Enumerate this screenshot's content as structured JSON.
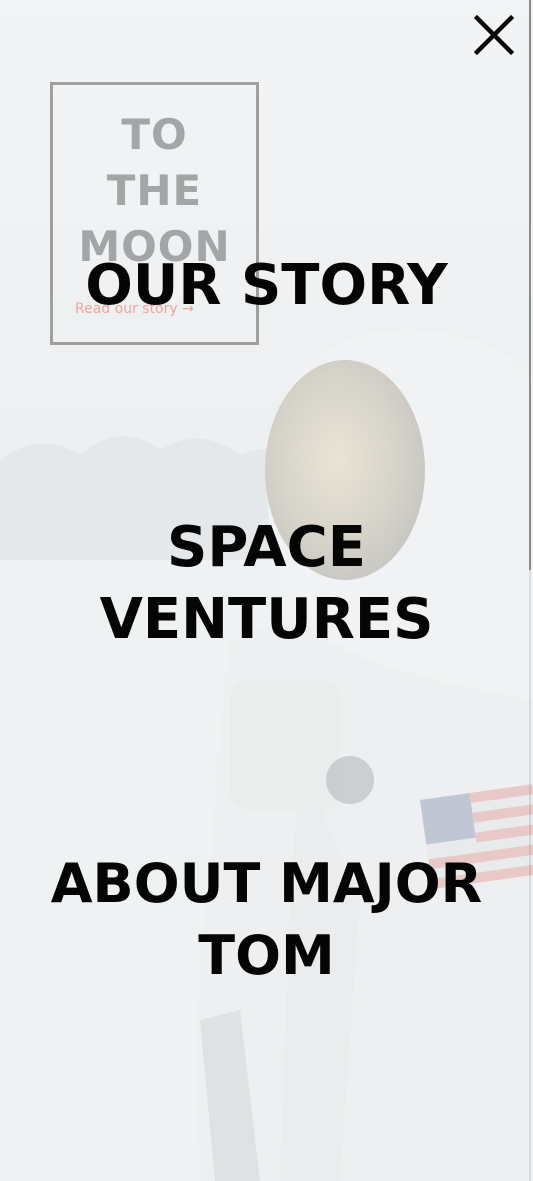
{
  "hero": {
    "title": "TO\nTHE\nMOON",
    "link": "Read our story →"
  },
  "menu": {
    "items": [
      {
        "lines": [
          "OUR STORY"
        ]
      },
      {
        "lines": [
          "SPACE",
          "VENTURES"
        ]
      },
      {
        "lines": [
          "ABOUT MAJOR",
          "TOM"
        ]
      }
    ]
  },
  "icons": {
    "close": "close-icon"
  },
  "colors": {
    "menu_text": "#050505",
    "overlay": "#f5f7f8",
    "hero_text": "#a3a5a6",
    "link_accent": "#f0a49a"
  }
}
